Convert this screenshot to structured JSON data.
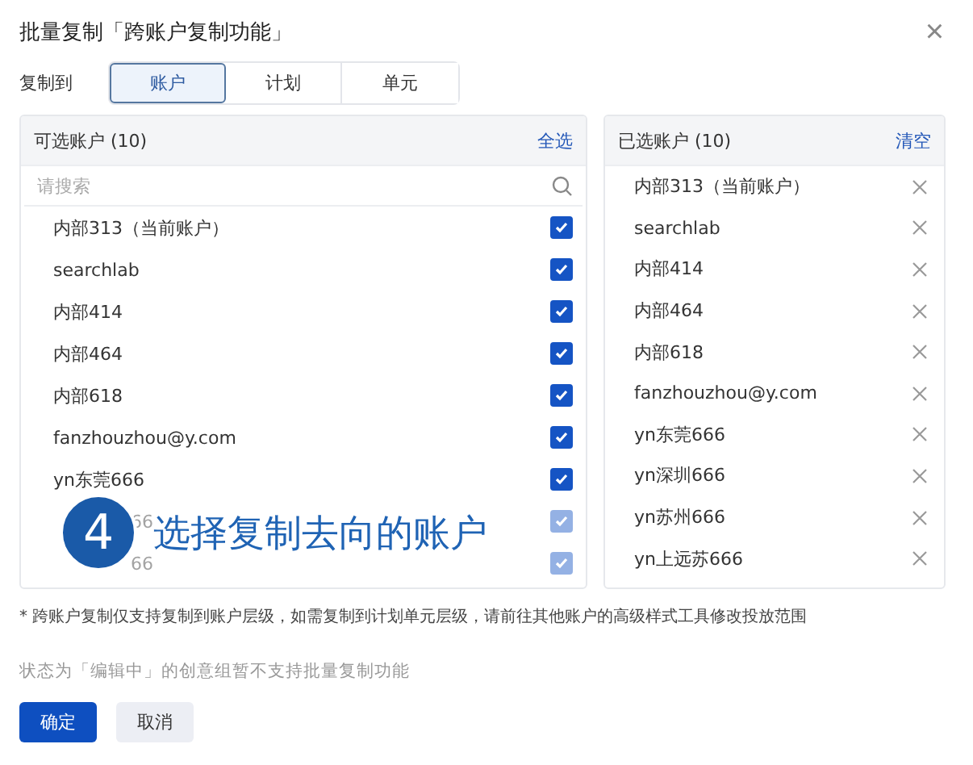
{
  "dialog": {
    "title": "批量复制「跨账户复制功能」",
    "close": "×"
  },
  "copy_to": {
    "label": "复制到",
    "tabs": [
      {
        "label": "账户",
        "selected": true
      },
      {
        "label": "计划",
        "selected": false
      },
      {
        "label": "单元",
        "selected": false
      }
    ]
  },
  "available": {
    "title": "可选账户 (10)",
    "action": "全选",
    "search": {
      "placeholder": "请搜索"
    },
    "items": [
      {
        "name": "内部313（当前账户）",
        "checked": true,
        "covered": false
      },
      {
        "name": "searchlab",
        "checked": true,
        "covered": false
      },
      {
        "name": "内部414",
        "checked": true,
        "covered": false
      },
      {
        "name": "内部464",
        "checked": true,
        "covered": false
      },
      {
        "name": "内部618",
        "checked": true,
        "covered": false
      },
      {
        "name": "fanzhouzhou@y.com",
        "checked": true,
        "covered": false
      },
      {
        "name": "yn东莞666",
        "checked": true,
        "covered": false
      },
      {
        "name": "66",
        "checked": true,
        "covered": true
      },
      {
        "name": "66",
        "checked": true,
        "covered": true
      }
    ]
  },
  "selected": {
    "title": "已选账户 (10)",
    "action": "清空",
    "items": [
      "内部313（当前账户）",
      "searchlab",
      "内部414",
      "内部464",
      "内部618",
      "fanzhouzhou@y.com",
      "yn东莞666",
      "yn深圳666",
      "yn苏州666",
      "yn上远苏666"
    ]
  },
  "note": "* 跨账户复制仅支持复制到账户层级，如需复制到计划单元层级，请前往其他账户的高级样式工具修改投放范围",
  "hint": "状态为「编辑中」的创意组暂不支持批量复制功能",
  "buttons": [
    {
      "label": "确定",
      "kind": "primary"
    },
    {
      "label": "取消",
      "kind": "secondary"
    }
  ],
  "overlay": {
    "step": "4",
    "caption": "选择复制去向的账户"
  }
}
